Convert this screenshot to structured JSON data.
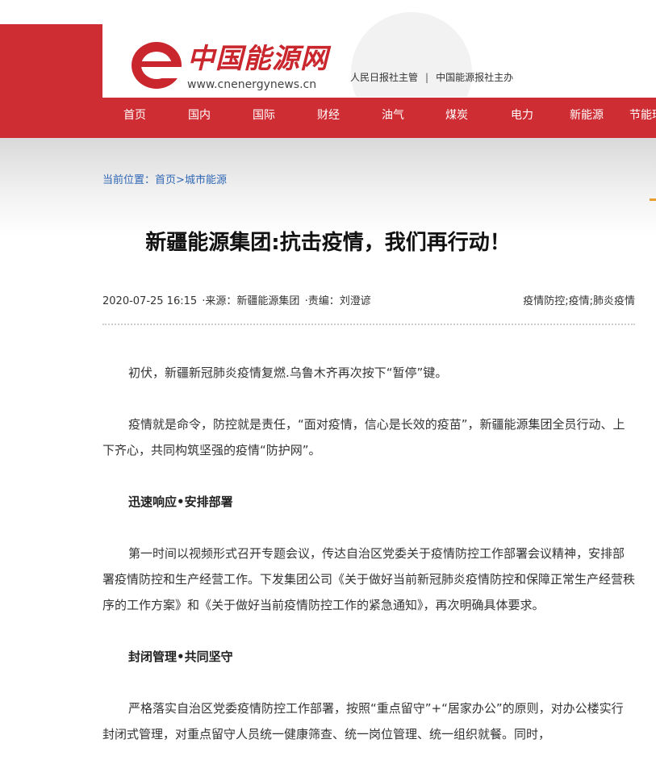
{
  "site": {
    "logo_text": "中国能源网",
    "logo_url": "www.cnenergynews.cn",
    "sponsor_1": "人民日报社主管",
    "sponsor_sep": "|",
    "sponsor_2": "中国能源报社主办"
  },
  "nav": {
    "items": [
      {
        "label": "首页"
      },
      {
        "label": "国内"
      },
      {
        "label": "国际"
      },
      {
        "label": "财经"
      },
      {
        "label": "油气"
      },
      {
        "label": "煤炭"
      },
      {
        "label": "电力"
      },
      {
        "label": "新能源"
      },
      {
        "label": "节能环"
      }
    ]
  },
  "breadcrumb": {
    "prefix": "当前位置：",
    "home": "首页",
    "sep": ">",
    "section": "城市能源"
  },
  "article": {
    "title": "新疆能源集团:抗击疫情，我们再行动！",
    "date": "2020-07-25 16:15",
    "source": "·来源：新疆能源集团",
    "editor": "·责编：刘澄谚",
    "tags": "疫情防控;疫情;肺炎疫情",
    "paragraphs": [
      "初伏，新疆新冠肺炎疫情复燃.乌鲁木齐再次按下“暂停”键。",
      "疫情就是命令，防控就是责任，“面对疫情，信心是长效的疫苗”，新疆能源集团全员行动、上下齐心，共同构筑坚强的疫情“防护网”。",
      "迅速响应•安排部署",
      "第一时间以视频形式召开专题会议，传达自治区党委关于疫情防控工作部署会议精神，安排部署疫情防控和生产经营工作。下发集团公司《关于做好当前新冠肺炎疫情防控和保障正常生产经营秩序的工作方案》和《关于做好当前疫情防控工作的紧急通知》，再次明确具体要求。",
      "封闭管理•共同坚守",
      "严格落实自治区党委疫情防控工作部署，按照“重点留守”+“居家办公”的原则，对办公楼实行封闭式管理，对重点留守人员统一健康筛查、统一岗位管理、统一组织就餐。同时，"
    ]
  },
  "colors": {
    "brand_red": "#cf2d34",
    "link_blue": "#2f67b5"
  }
}
